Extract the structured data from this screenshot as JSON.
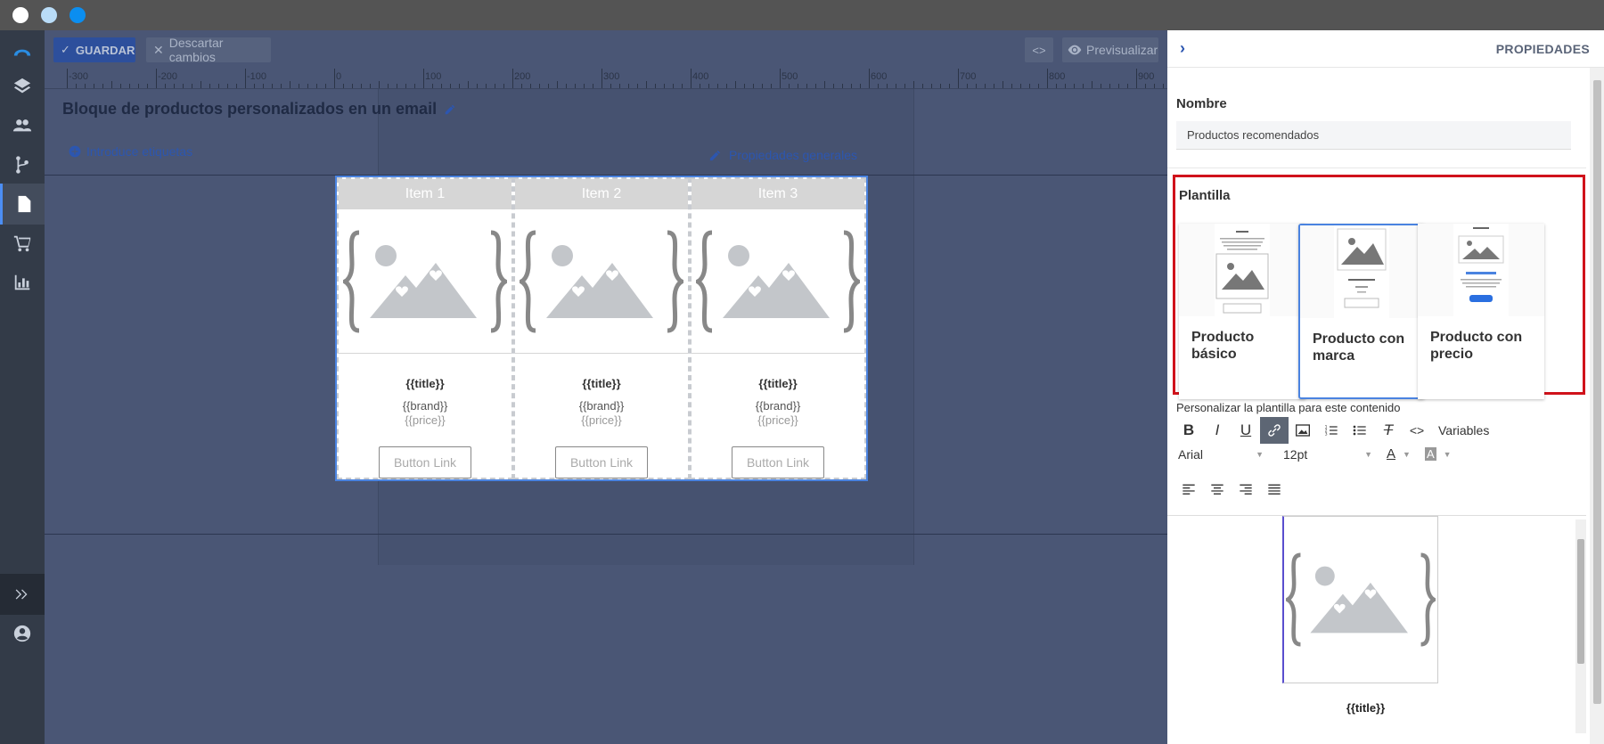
{
  "window": {
    "dots": [
      "#ffffff",
      "#b9dcf7",
      "#0b8ef0"
    ]
  },
  "toolbar": {
    "save_label": "GUARDAR",
    "discard_label": "Descartar cambios",
    "code_label": "<>",
    "preview_label": "Previsualizar"
  },
  "ruler": {
    "labels": [
      "-300",
      "-200",
      "-100",
      "0",
      "100",
      "200",
      "300",
      "400",
      "500",
      "600",
      "700",
      "800",
      "900"
    ]
  },
  "page": {
    "title": "Bloque de productos personalizados en un email",
    "tags_label": "Introduce etiquetas",
    "general_props_label": "Propiedades generales"
  },
  "block": {
    "items": [
      {
        "header": "Item 1",
        "title": "{{title}}",
        "brand": "{{brand}}",
        "price": "{{price}}",
        "button": "Button Link"
      },
      {
        "header": "Item 2",
        "title": "{{title}}",
        "brand": "{{brand}}",
        "price": "{{price}}",
        "button": "Button Link"
      },
      {
        "header": "Item 3",
        "title": "{{title}}",
        "brand": "{{brand}}",
        "price": "{{price}}",
        "button": "Button Link"
      }
    ]
  },
  "panel": {
    "title": "PROPIEDADES",
    "name_label": "Nombre",
    "name_value": "Productos recomendados",
    "template_label": "Plantilla",
    "templates": [
      {
        "name": "Producto básico",
        "selected": false
      },
      {
        "name": "Producto con marca",
        "selected": true
      },
      {
        "name": "Producto con precio",
        "selected": false
      }
    ],
    "customize_label": "Personalizar la plantilla para este contenido",
    "editor": {
      "variables_label": "Variables",
      "font_value": "Arial",
      "size_value": "12pt",
      "preview_title": "{{title}}"
    }
  },
  "colors": {
    "accent": "#4a83e0",
    "highlight": "#d0121b",
    "save": "#2d4f9c"
  }
}
